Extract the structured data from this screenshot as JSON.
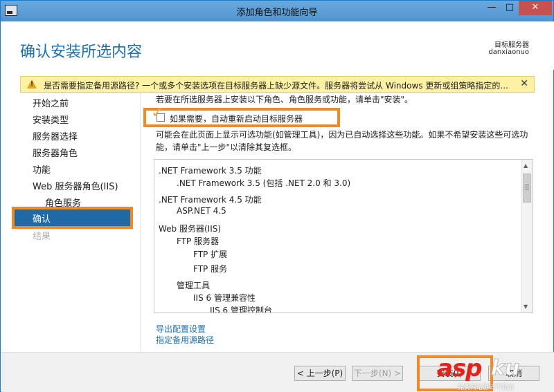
{
  "window": {
    "title": "添加角色和功能向导",
    "minimize": "—",
    "maximize": "□",
    "close": "✕"
  },
  "header": {
    "page_title": "确认安装所选内容",
    "target_server_label": "目标服务器",
    "target_server_name": "danxiaonuo"
  },
  "warning": {
    "text": "是否需要指定备用源路径? 一个或多个安装选项在目标服务器上缺少源文件。服务器将尝试从 Windows 更新或组策略指定的...",
    "close": "✕"
  },
  "nav": {
    "items": [
      {
        "label": "开始之前"
      },
      {
        "label": "安装类型"
      },
      {
        "label": "服务器选择"
      },
      {
        "label": "服务器角色"
      },
      {
        "label": "功能"
      },
      {
        "label": "Web 服务器角色(IIS)"
      },
      {
        "label": "角色服务"
      },
      {
        "label": "确认"
      },
      {
        "label": "结果"
      }
    ]
  },
  "main": {
    "intro": "若要在所选服务器上安装以下角色、角色服务或功能，请单击\"安装\"。",
    "restart_label": "如果需要，自动重新启动目标服务器",
    "note_line1": "可能会在此页面上显示可选功能(如管理工具)，因为已自动选择这些功能。如果不希望安装这些可选功",
    "note_line2": "能，请单击\"上一步\"以清除其复选框。",
    "features": [
      {
        "label": ".NET Framework 3.5 功能"
      },
      {
        "label": ".NET Framework 3.5 (包括 .NET 2.0 和 3.0)"
      },
      {
        "label": ".NET Framework 4.5 功能"
      },
      {
        "label": "ASP.NET 4.5"
      },
      {
        "label": "Web 服务器(IIS)"
      },
      {
        "label": "FTP 服务器"
      },
      {
        "label": "FTP 扩展"
      },
      {
        "label": "FTP 服务"
      },
      {
        "label": "管理工具"
      },
      {
        "label": "IIS 6 管理兼容性"
      },
      {
        "label": "IIS 6 管理控制台"
      }
    ],
    "links": {
      "export": "导出配置设置",
      "alt_source": "指定备用源路径"
    }
  },
  "buttons": {
    "prev": "< 上一步(P)",
    "next": "下一步(N) >",
    "install": "安装(I)",
    "cancel": "取消"
  },
  "watermark": {
    "asp": "asp",
    "ku": "ku",
    "sub": "免费网站源码下载站"
  },
  "colors": {
    "accent": "#1b6fb3",
    "highlight_outline": "#ec8a2c",
    "warning_bg": "#fdf1a4",
    "nav_active": "#1f6aa5"
  }
}
